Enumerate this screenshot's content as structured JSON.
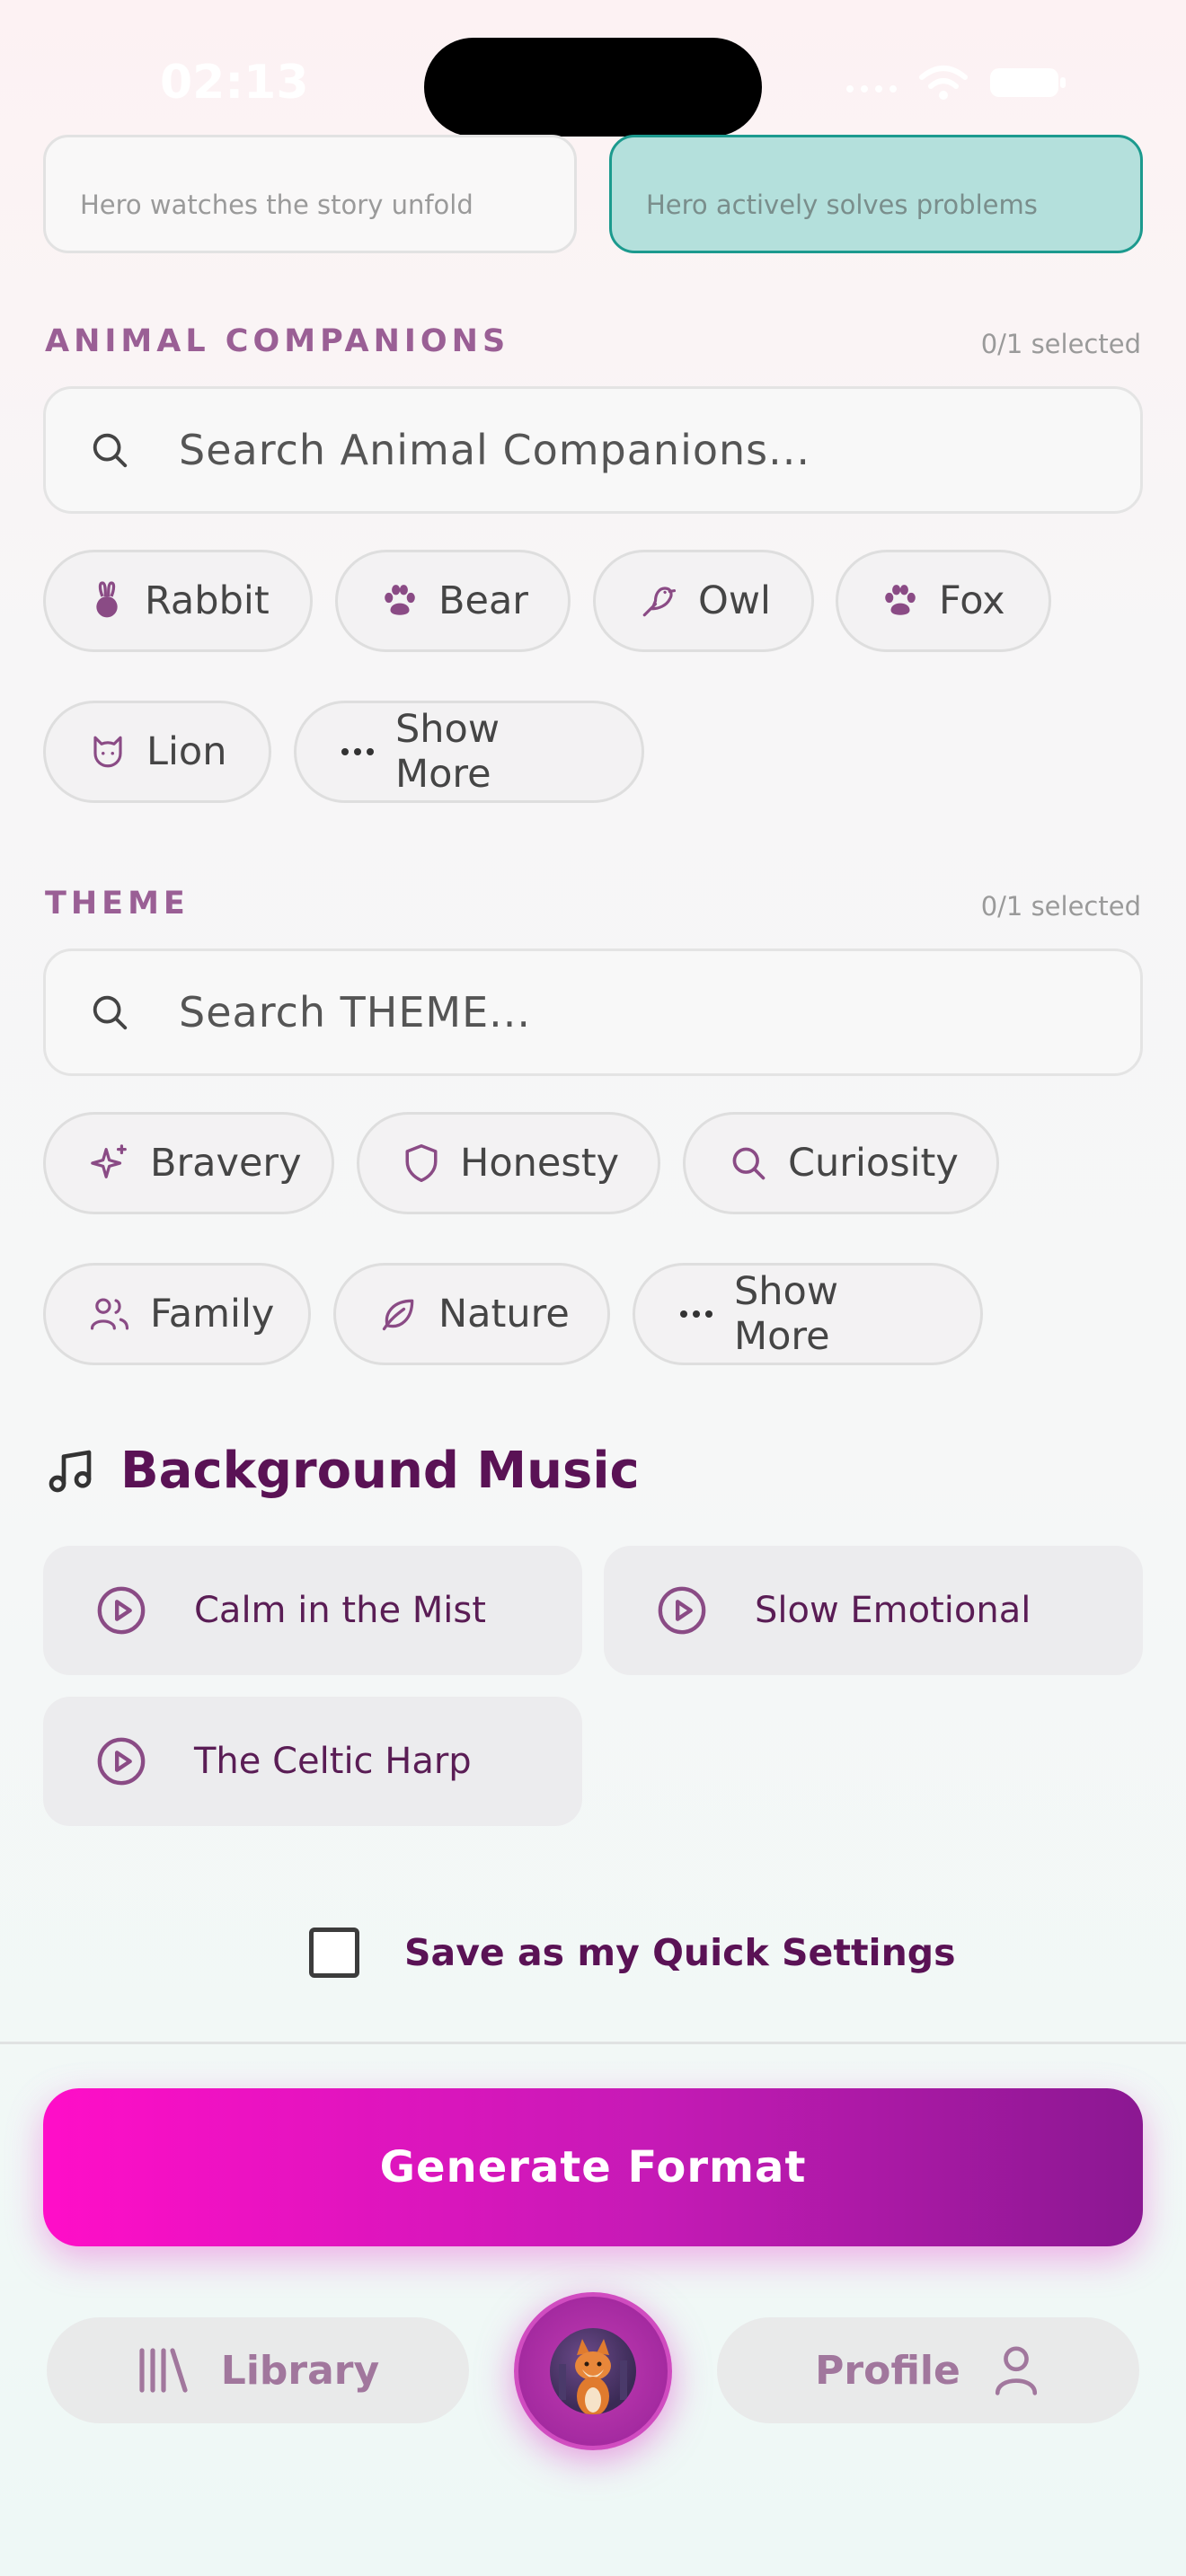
{
  "status": {
    "time": "02:13"
  },
  "hero_modes": {
    "passive": "Hero watches the story unfold",
    "active": "Hero actively solves problems"
  },
  "animal": {
    "title": "ANIMAL COMPANIONS",
    "count": "0/1 selected",
    "search_placeholder": "Search Animal Companions...",
    "chips": [
      {
        "label": "Rabbit",
        "icon": "rabbit-icon"
      },
      {
        "label": "Bear",
        "icon": "paw-icon"
      },
      {
        "label": "Owl",
        "icon": "bird-icon"
      },
      {
        "label": "Fox",
        "icon": "paw-icon"
      },
      {
        "label": "Lion",
        "icon": "cat-icon"
      },
      {
        "label": "Show More",
        "icon": "more-icon"
      }
    ]
  },
  "theme": {
    "title": "THEME",
    "count": "0/1 selected",
    "search_placeholder": "Search THEME...",
    "chips": [
      {
        "label": "Bravery",
        "icon": "sparkles-icon"
      },
      {
        "label": "Honesty",
        "icon": "shield-icon"
      },
      {
        "label": "Curiosity",
        "icon": "search-icon"
      },
      {
        "label": "Family",
        "icon": "users-icon"
      },
      {
        "label": "Nature",
        "icon": "leaf-icon"
      },
      {
        "label": "Show More",
        "icon": "more-icon"
      }
    ]
  },
  "music": {
    "title": "Background Music",
    "tracks": [
      "Calm in the Mist",
      "Slow Emotional",
      "The Celtic Harp"
    ]
  },
  "quick_settings": {
    "label": "Save as my Quick Settings",
    "checked": false
  },
  "generate": {
    "label": "Generate Format"
  },
  "nav": {
    "library": "Library",
    "profile": "Profile"
  },
  "colors": {
    "accent": "#9a5f95",
    "brand_dark": "#5a1255",
    "gradient_start": "#ff0ec8",
    "gradient_end": "#8b1892",
    "selected_bg": "#b4e0dc"
  }
}
